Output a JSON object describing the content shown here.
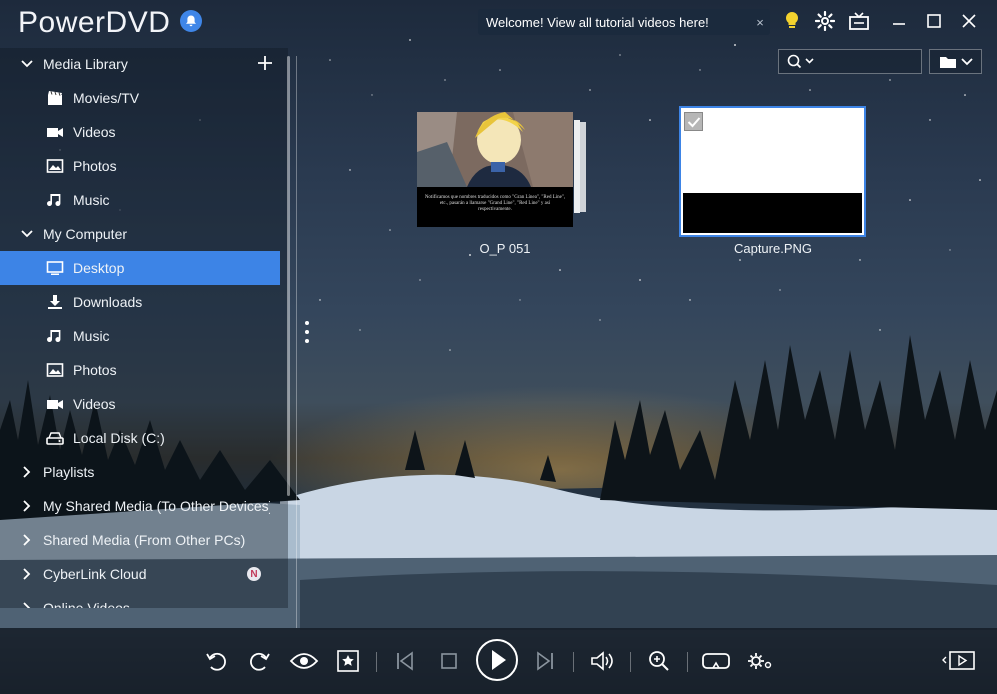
{
  "app": {
    "title": "PowerDVD"
  },
  "titlebar": {
    "tutorial_text": "Welcome! View all tutorial videos here!",
    "close_glyph": "×",
    "icons": [
      "bell-icon",
      "lightbulb-icon",
      "gear-icon",
      "tv-mode-icon",
      "minimize-icon",
      "maximize-icon",
      "close-icon"
    ]
  },
  "search": {
    "placeholder": ""
  },
  "sidebar": {
    "media_library": "Media Library",
    "library_items": [
      {
        "label": "Movies/TV",
        "icon": "movies-icon"
      },
      {
        "label": "Videos",
        "icon": "video-icon"
      },
      {
        "label": "Photos",
        "icon": "photo-icon"
      },
      {
        "label": "Music",
        "icon": "music-icon"
      }
    ],
    "my_computer": "My Computer",
    "computer_items": [
      {
        "label": "Desktop",
        "icon": "desktop-icon",
        "selected": true
      },
      {
        "label": "Downloads",
        "icon": "download-icon"
      },
      {
        "label": "Music",
        "icon": "music-icon"
      },
      {
        "label": "Photos",
        "icon": "photo-icon"
      },
      {
        "label": "Videos",
        "icon": "video-icon"
      },
      {
        "label": "Local Disk (C:)",
        "icon": "disk-icon"
      }
    ],
    "playlists": "Playlists",
    "my_shared_media": "My Shared Media (To Other Devices)",
    "shared_media": "Shared Media (From Other PCs)",
    "cyberlink_cloud": "CyberLink Cloud",
    "cloud_badge": "N",
    "online_videos": "Online Videos"
  },
  "content": {
    "tiles": [
      {
        "name": "O_P 051",
        "thumb_caption": "Notificamos que nombres traducidos como \"Gran Línea\", \"Red Line\", etc., pasarán a llamarse \"Grand Line\", \"Red Line\" y así respectivamente."
      },
      {
        "name": "Capture.PNG",
        "checked": true
      }
    ]
  },
  "player": {
    "buttons": [
      "rotate-left-icon",
      "rotate-right-icon",
      "eye-icon",
      "favorite-star-icon",
      "previous-icon",
      "stop-icon",
      "play-icon",
      "next-icon",
      "volume-icon",
      "zoom-icon",
      "vr-icon",
      "settings-icon",
      "mini-player-icon"
    ]
  },
  "colors": {
    "accent": "#3d84e6",
    "bell": "#3f86e8",
    "lightbulb": "#f3d22e"
  }
}
